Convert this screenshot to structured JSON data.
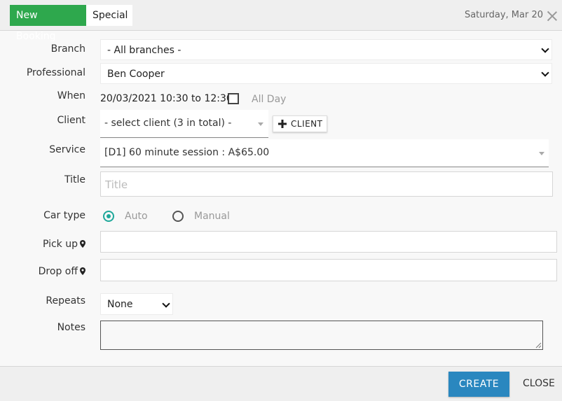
{
  "header": {
    "tabs": [
      {
        "label": "New Booking",
        "active": true
      },
      {
        "label": "Special",
        "active": false
      }
    ],
    "date": "Saturday, Mar 20"
  },
  "form": {
    "branch": {
      "label": "Branch",
      "value": "- All branches -"
    },
    "professional": {
      "label": "Professional",
      "value": "Ben Cooper"
    },
    "when": {
      "label": "When",
      "value": "20/03/2021 10:30 to 12:30",
      "all_day_label": "All Day",
      "all_day_checked": false
    },
    "client": {
      "label": "Client",
      "value": "- select client (3 in total) -",
      "add_button": "CLIENT"
    },
    "service": {
      "label": "Service",
      "value": "[D1] 60 minute session : A$65.00"
    },
    "title": {
      "label": "Title",
      "placeholder": "Title",
      "value": ""
    },
    "car_type": {
      "label": "Car type",
      "options": [
        {
          "label": "Auto",
          "selected": true
        },
        {
          "label": "Manual",
          "selected": false
        }
      ]
    },
    "pick_up": {
      "label": "Pick up",
      "value": ""
    },
    "drop_off": {
      "label": "Drop off",
      "value": ""
    },
    "repeats": {
      "label": "Repeats",
      "value": "None"
    },
    "notes": {
      "label": "Notes",
      "value": ""
    }
  },
  "footer": {
    "create_label": "CREATE",
    "close_label": "CLOSE"
  },
  "colors": {
    "tab_active": "#2ea84d",
    "radio_accent": "#1ea89a",
    "primary_button": "#2a87bf"
  }
}
